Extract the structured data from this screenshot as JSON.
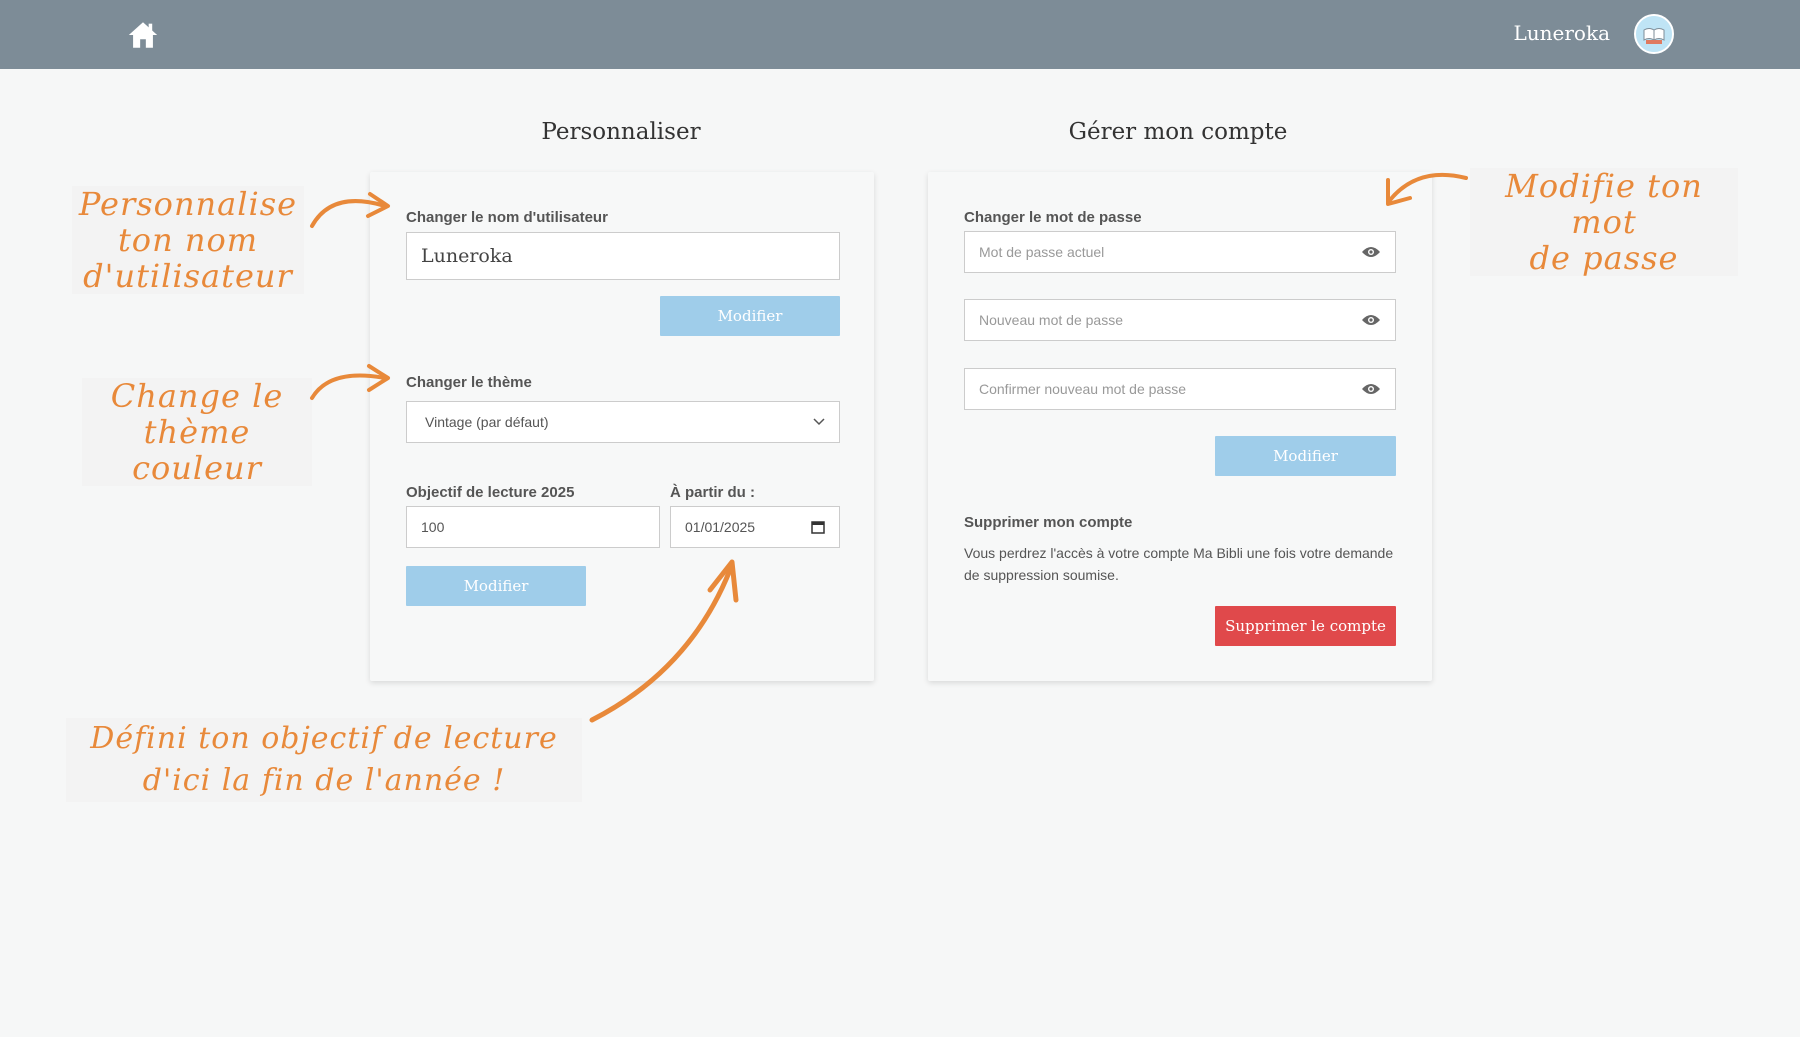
{
  "header": {
    "home_icon": "home-icon",
    "username": "Luneroka",
    "avatar_icon": "book-avatar-icon"
  },
  "personalize": {
    "title": "Personnaliser",
    "username_label": "Changer le nom d'utilisateur",
    "username_value": "Luneroka",
    "username_button": "Modifier",
    "theme_label": "Changer le thème",
    "theme_selected": "Vintage (par défaut)",
    "goal_label": "Objectif de lecture 2025",
    "goal_value": "100",
    "from_label": "À partir du :",
    "from_value": "01/01/2025",
    "goal_button": "Modifier"
  },
  "account": {
    "title": "Gérer mon compte",
    "password_label": "Changer le mot de passe",
    "current_placeholder": "Mot de passe actuel",
    "new_placeholder": "Nouveau mot de passe",
    "confirm_placeholder": "Confirmer nouveau mot de passe",
    "password_button": "Modifier",
    "delete_title": "Supprimer mon compte",
    "delete_desc_line1": "Vous perdrez l'accès à votre compte Ma Bibli une fois votre demande",
    "delete_desc_line2": "de suppression soumise.",
    "delete_button": "Supprimer le compte"
  },
  "annotations": {
    "username_note": [
      "Personnalise",
      "ton nom",
      "d'utilisateur"
    ],
    "theme_note": [
      "Change le",
      "thème couleur"
    ],
    "goal_note": [
      "Défini ton objectif de lecture",
      "d'ici la fin de l'année !"
    ],
    "password_note": [
      "Modifie ton mot",
      "de passe"
    ]
  },
  "colors": {
    "topbar": "#7d8c97",
    "button": "#9fcdea",
    "danger": "#e0494b",
    "annotation": "#e8893a"
  }
}
